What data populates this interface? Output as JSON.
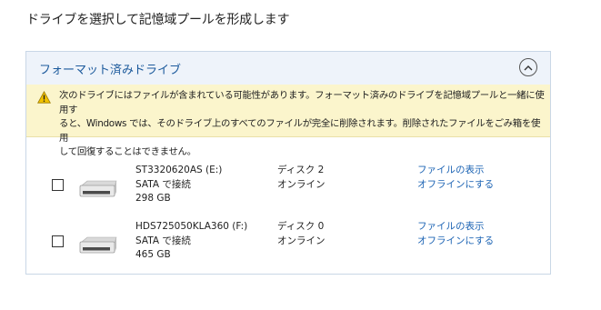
{
  "page": {
    "title": "ドライブを選択して記憶域プールを形成します"
  },
  "panel": {
    "title": "フォーマット済みドライブ",
    "collapse_icon": "chevron-up-icon",
    "warning": {
      "icon": "warning-icon",
      "lines": [
        "次のドライブにはファイルが含まれている可能性があります。フォーマット済みのドライブを記憶域プールと一緒に使用す",
        "ると、Windows では、そのドライブ上のすべてのファイルが完全に削除されます。削除されたファイルをごみ箱を使用",
        "して回復することはできません。"
      ]
    },
    "drives": [
      {
        "name": "ST3320620AS (E:)",
        "connection": "SATA で接続",
        "size": "298 GB",
        "disk": "ディスク 2",
        "status": "オンライン",
        "link_view": "ファイルの表示",
        "link_offline": "オフラインにする",
        "checked": false
      },
      {
        "name": "HDS725050KLA360 (F:)",
        "connection": "SATA で接続",
        "size": "465 GB",
        "disk": "ディスク 0",
        "status": "オンライン",
        "link_view": "ファイルの表示",
        "link_offline": "オフラインにする",
        "checked": false
      }
    ]
  },
  "colors": {
    "link": "#1d64b4",
    "header_bg": "#eef3fa",
    "header_text": "#1c5a9c",
    "warning_bg": "#fbf5cc",
    "warning_icon": "#f2c200"
  }
}
